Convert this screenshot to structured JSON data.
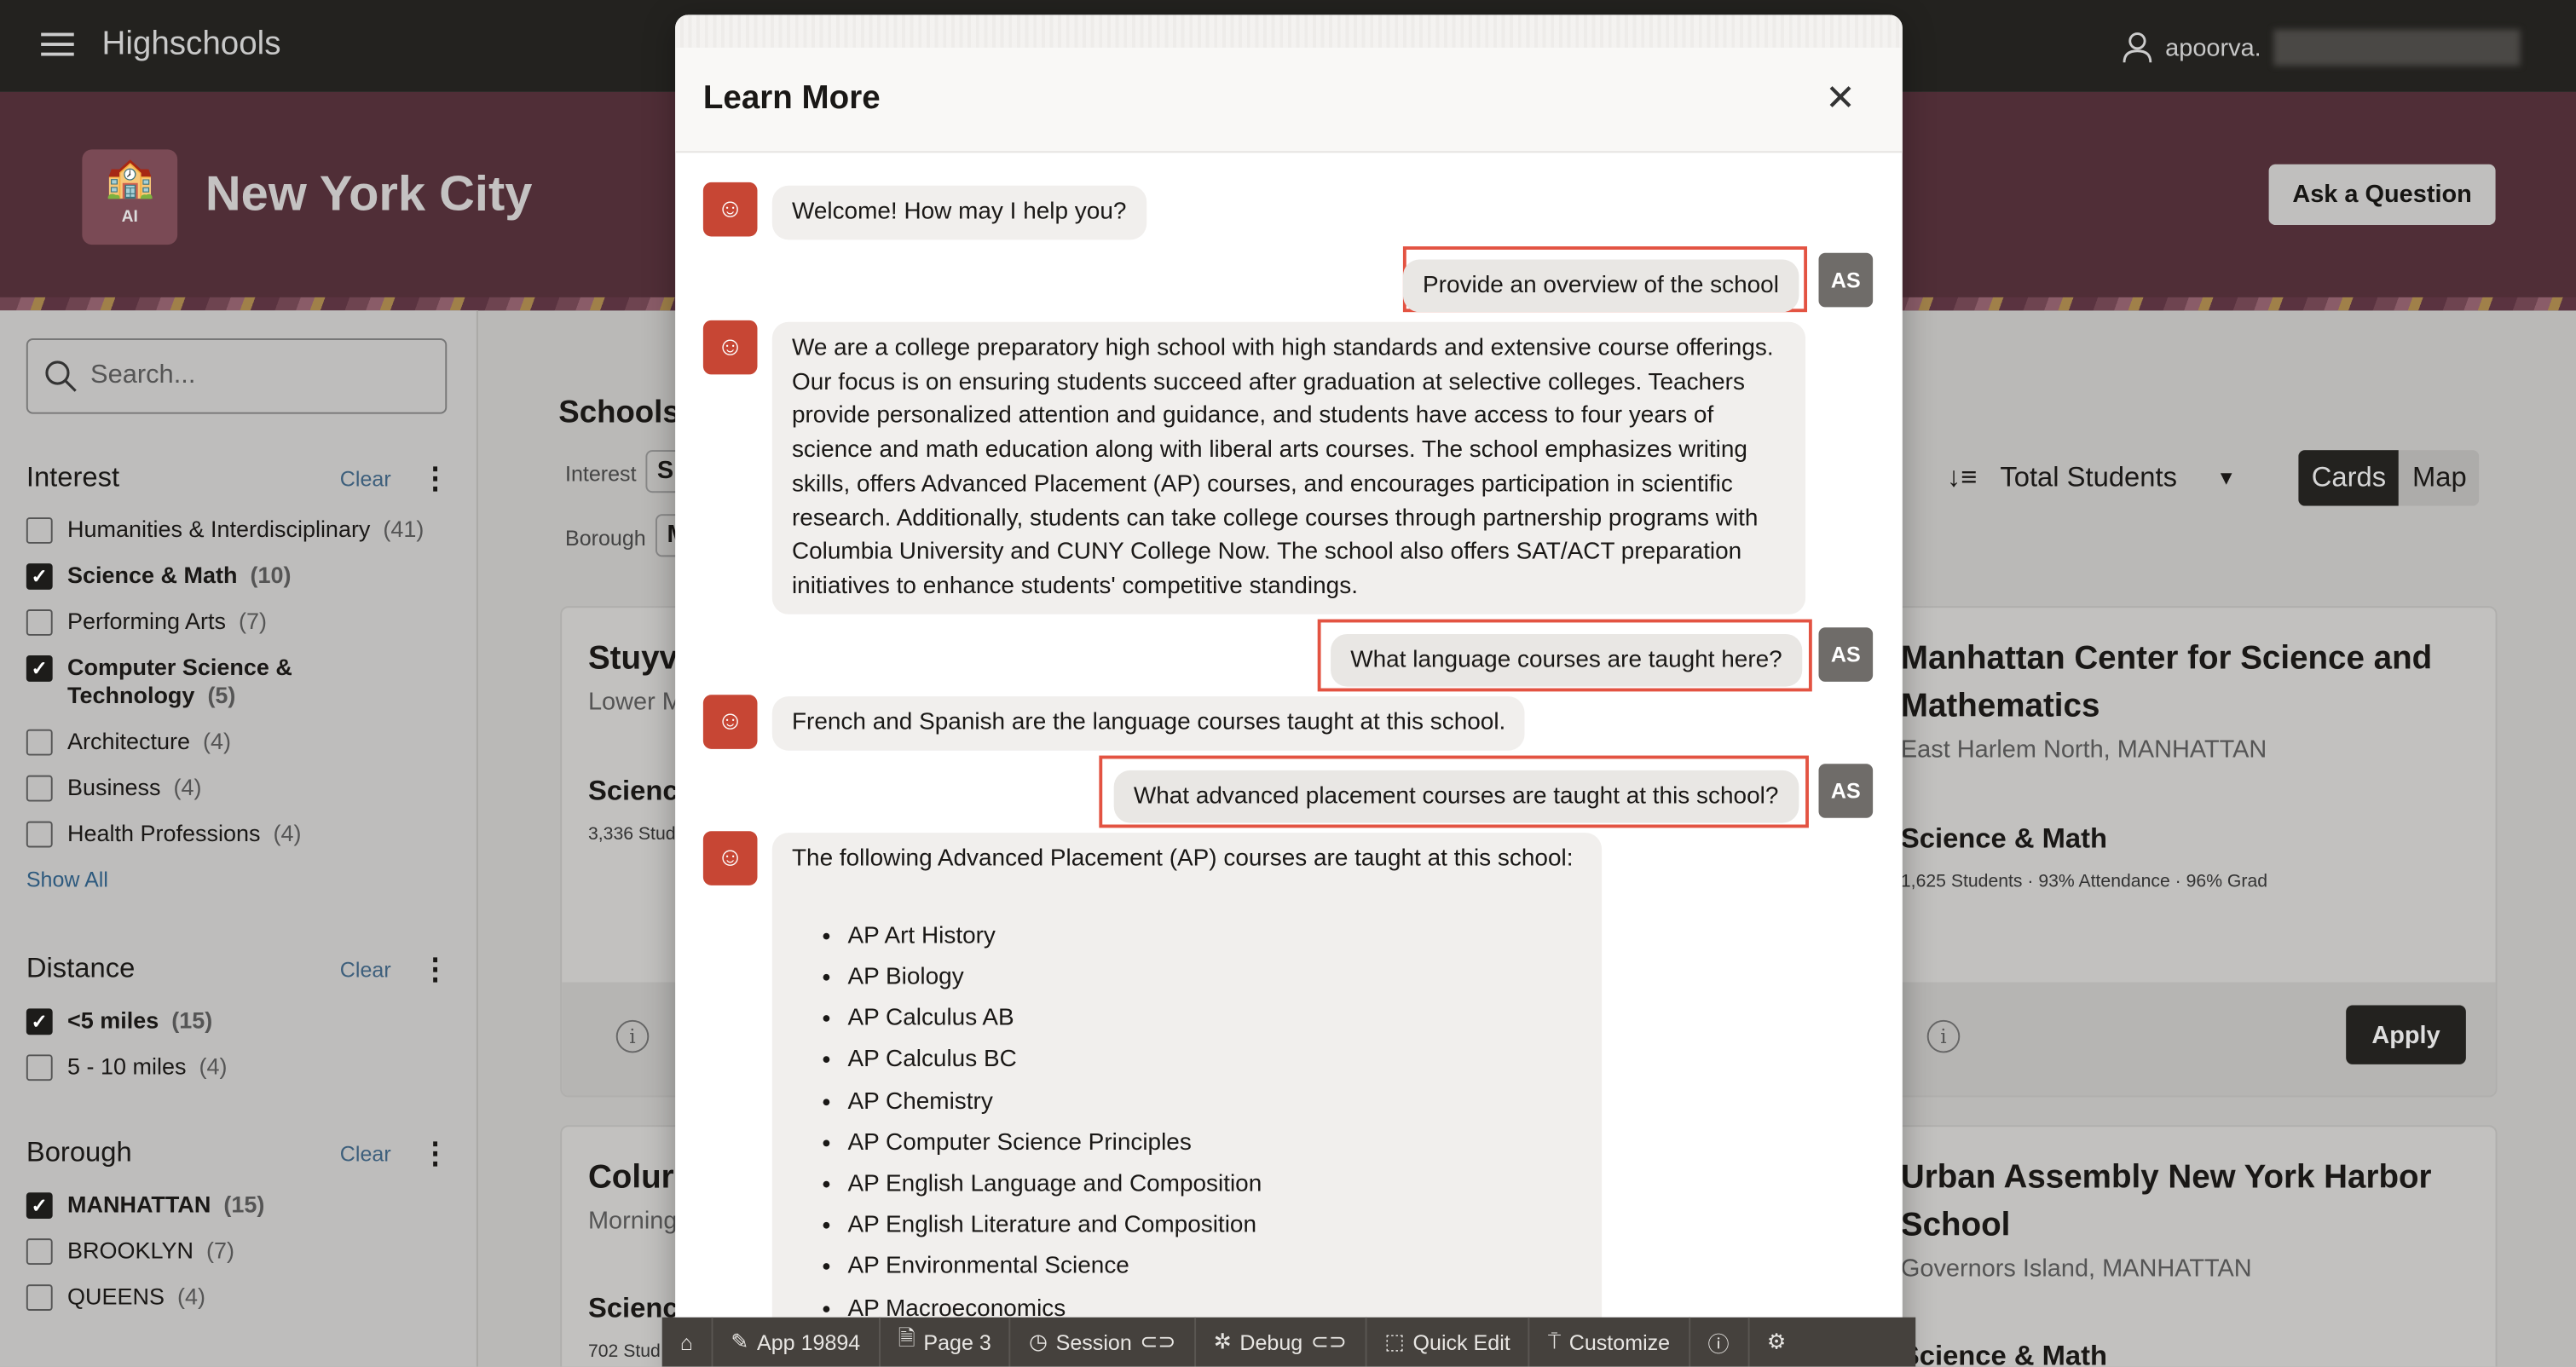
{
  "app": {
    "title": "Highschools",
    "user": "apoorva."
  },
  "hero": {
    "title": "New York City",
    "logo_text": "AI",
    "ask_button": "Ask a Question"
  },
  "sidebar": {
    "search_placeholder": "Search...",
    "interest": {
      "title": "Interest",
      "clear": "Clear",
      "show_all": "Show All",
      "options": [
        {
          "label": "Humanities & Interdisciplinary",
          "count": "(41)",
          "checked": false
        },
        {
          "label": "Science & Math",
          "count": "(10)",
          "checked": true
        },
        {
          "label": "Performing Arts",
          "count": "(7)",
          "checked": false
        },
        {
          "label": "Computer Science & Technology",
          "count": "(5)",
          "checked": true
        },
        {
          "label": "Architecture",
          "count": "(4)",
          "checked": false
        },
        {
          "label": "Business",
          "count": "(4)",
          "checked": false
        },
        {
          "label": "Health Professions",
          "count": "(4)",
          "checked": false
        }
      ]
    },
    "distance": {
      "title": "Distance",
      "clear": "Clear",
      "options": [
        {
          "label": "<5 miles",
          "count": "(15)",
          "checked": true
        },
        {
          "label": "5 - 10 miles",
          "count": "(4)",
          "checked": false
        }
      ]
    },
    "borough": {
      "title": "Borough",
      "clear": "Clear",
      "options": [
        {
          "label": "MANHATTAN",
          "count": "(15)",
          "checked": true
        },
        {
          "label": "BROOKLYN",
          "count": "(7)",
          "checked": false
        },
        {
          "label": "QUEENS",
          "count": "(4)",
          "checked": false
        }
      ]
    }
  },
  "main": {
    "heading": "Schools:",
    "filter_interest_label": "Interest",
    "filter_interest_value": "S",
    "filter_borough_label": "Borough",
    "filter_borough_value": "M",
    "sort_label": "Total Students",
    "view_cards": "Cards",
    "view_map": "Map",
    "apply": "Apply",
    "cards": [
      {
        "name": "Stuyv",
        "location": "Lower M",
        "interest": "Scienc",
        "stats": "3,336 Stud"
      },
      {
        "name": "Manhattan Center for Science and Mathematics",
        "location": "East Harlem North, MANHATTAN",
        "interest": "Science & Math",
        "stats": "1,625 Students · 93% Attendance · 96% Grad"
      },
      {
        "name": "Colur",
        "location": "Morning",
        "interest": "Scienc",
        "stats": "702 Stud"
      },
      {
        "name": "Urban Assembly New York Harbor School",
        "location": "Governors Island, MANHATTAN",
        "interest": "Science & Math"
      }
    ]
  },
  "modal": {
    "title": "Learn More",
    "user_initials": "AS",
    "messages": [
      {
        "role": "bot",
        "text": "Welcome! How may I help you?"
      },
      {
        "role": "user",
        "text": "Provide an overview of the school"
      },
      {
        "role": "bot",
        "text": "We are a college preparatory high school with high standards and extensive course offerings. Our focus is on ensuring students succeed after graduation at selective colleges. Teachers provide personalized attention and guidance, and students have access to four years of science and math education along with liberal arts courses. The school emphasizes writing skills, offers Advanced Placement (AP) courses, and encourages participation in scientific research. Additionally, students can take college courses through partnership programs with Columbia University and CUNY College Now. The school also offers SAT/ACT preparation initiatives to enhance students' competitive standings."
      },
      {
        "role": "user",
        "text": "What language courses are taught here?"
      },
      {
        "role": "bot",
        "text": "French and Spanish are the language courses taught at this school."
      },
      {
        "role": "user",
        "text": "What advanced placement courses are taught at this school?"
      },
      {
        "role": "bot",
        "text": "The following Advanced Placement (AP) courses are taught at this school:"
      }
    ],
    "ap_courses": [
      "AP Art History",
      "AP Biology",
      "AP Calculus AB",
      "AP Calculus BC",
      "AP Chemistry",
      "AP Computer Science Principles",
      "AP English Language and Composition",
      "AP English Literature and Composition",
      "AP Environmental Science",
      "AP Macroeconomics"
    ]
  },
  "devbar": {
    "app": "App 19894",
    "page": "Page 3",
    "session": "Session",
    "debug": "Debug",
    "quick_edit": "Quick Edit",
    "customize": "Customize"
  },
  "colors": {
    "header": "#23221f",
    "hero": "#502e37",
    "bot_avatar": "#c74634",
    "highlight": "#e35342"
  }
}
